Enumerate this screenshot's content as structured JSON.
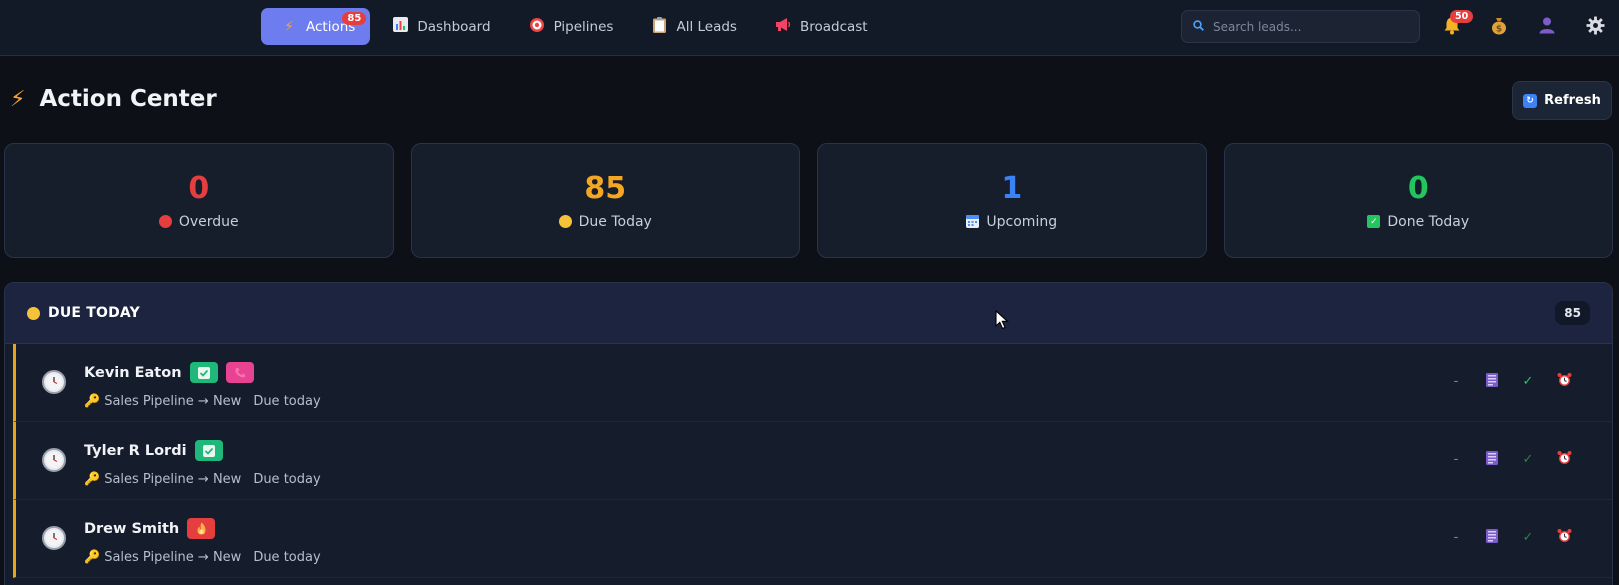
{
  "nav": {
    "tabs": [
      {
        "label": "Actions",
        "icon": "bolt-icon",
        "badge": "85",
        "active": true
      },
      {
        "label": "Dashboard",
        "icon": "bar-chart-icon"
      },
      {
        "label": "Pipelines",
        "icon": "target-icon"
      },
      {
        "label": "All Leads",
        "icon": "clipboard-icon"
      },
      {
        "label": "Broadcast",
        "icon": "megaphone-icon"
      }
    ],
    "search_placeholder": "Search leads...",
    "notifications_badge": "50"
  },
  "header": {
    "title": "Action Center",
    "refresh_label": "Refresh"
  },
  "stats": [
    {
      "value": "0",
      "label": "Overdue",
      "color": "#e53e3e"
    },
    {
      "value": "85",
      "label": "Due Today",
      "color": "#f5a623"
    },
    {
      "value": "1",
      "label": "Upcoming",
      "color": "#3b82f6"
    },
    {
      "value": "0",
      "label": "Done Today",
      "color": "#22c55e"
    }
  ],
  "section": {
    "title": "DUE TODAY",
    "count": "85",
    "rows": [
      {
        "name": "Kevin Eaton",
        "pipeline": "Sales Pipeline → New",
        "due": "Due today",
        "tags": [
          "check-tag",
          "phone-tag"
        ],
        "actions_dash": "-"
      },
      {
        "name": "Tyler R Lordi",
        "pipeline": "Sales Pipeline → New",
        "due": "Due today",
        "tags": [
          "check-tag"
        ],
        "actions_dash": "-"
      },
      {
        "name": "Drew Smith",
        "pipeline": "Sales Pipeline → New",
        "due": "Due today",
        "tags": [
          "fire-tag"
        ],
        "actions_dash": "-"
      }
    ]
  },
  "colors": {
    "accent": "#6d7df0",
    "due_border": "#e8a317",
    "badge_red": "#e53e3e"
  }
}
